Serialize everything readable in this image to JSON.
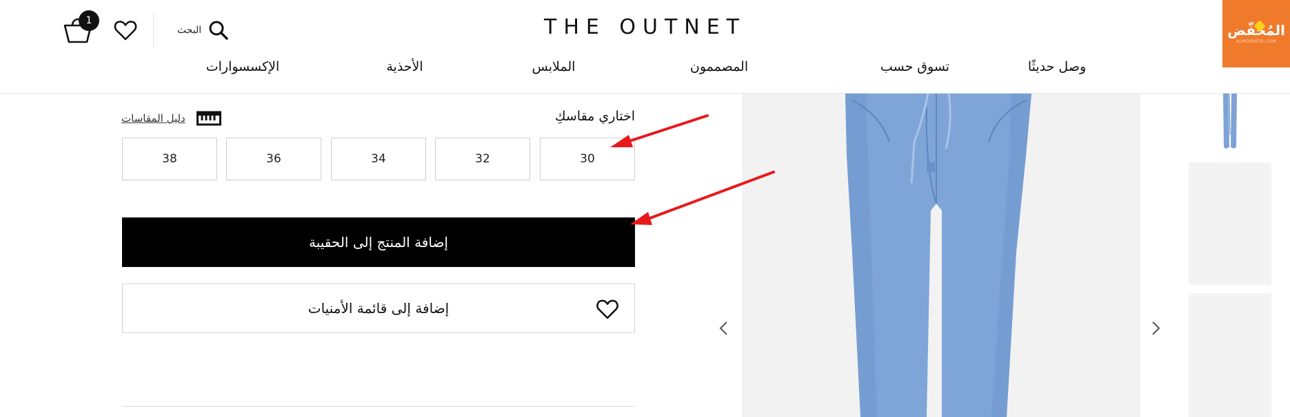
{
  "header": {
    "logo": "THE OUTNET",
    "badge_text": "المُخفّض",
    "badge_subtext": "ALMOKHFID.COM",
    "bag_count": "1",
    "search_label": "البحث",
    "nav": [
      {
        "label": "وصل حديثًا"
      },
      {
        "label": "تسوق حسب"
      },
      {
        "label": "المصممون"
      },
      {
        "label": "الملابس"
      },
      {
        "label": "الأحذية"
      },
      {
        "label": "الإكسسوارات"
      }
    ]
  },
  "product": {
    "size_title": "اختاري مقاسكِ",
    "size_guide_label": "دليل المقاسات",
    "sizes": [
      "30",
      "32",
      "34",
      "36",
      "38"
    ],
    "add_to_bag_label": "إضافة المنتج إلى الحقيبة",
    "add_to_wishlist_label": "إضافة إلى قائمة الأمنيات"
  },
  "colors": {
    "badge": "#f07a2b",
    "primary_button": "#000000",
    "annotation_arrow": "#e8191c",
    "jeans": "#7ea3d6"
  },
  "icons": [
    "bag-icon",
    "heart-icon",
    "search-icon",
    "ruler-icon",
    "chevron-left-icon",
    "chevron-right-icon"
  ]
}
